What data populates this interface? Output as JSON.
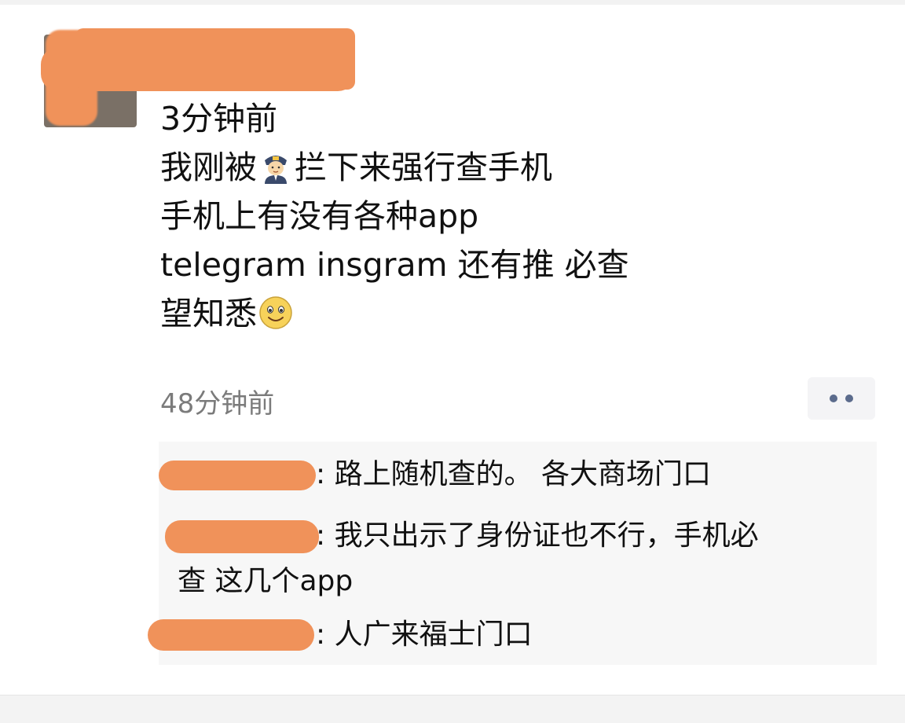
{
  "post": {
    "time_top": "3分钟前",
    "lines": {
      "l1_a": "我刚被",
      "l1_b": "拦下来强行查手机",
      "l2": "手机上有没有各种app",
      "l3": "telegram insgram 还有推 必查",
      "l4": "望知悉"
    },
    "emoji_1": "police-officer-emoji",
    "emoji_2": "smiling-face-emoji",
    "timestamp": "48分钟前"
  },
  "comments": [
    {
      "text": ": 路上随机查的。 各大商场门口"
    },
    {
      "text_1": ": 我只出示了身份证也不行，手机必",
      "text_2": "查 这几个app"
    },
    {
      "text": ": 人广来福士门口"
    }
  ],
  "colors": {
    "redaction": "#f0925a",
    "timestamp": "#7b7b7b",
    "comments_bg": "#f7f7f7",
    "more_dots": "#5b6b8c"
  }
}
